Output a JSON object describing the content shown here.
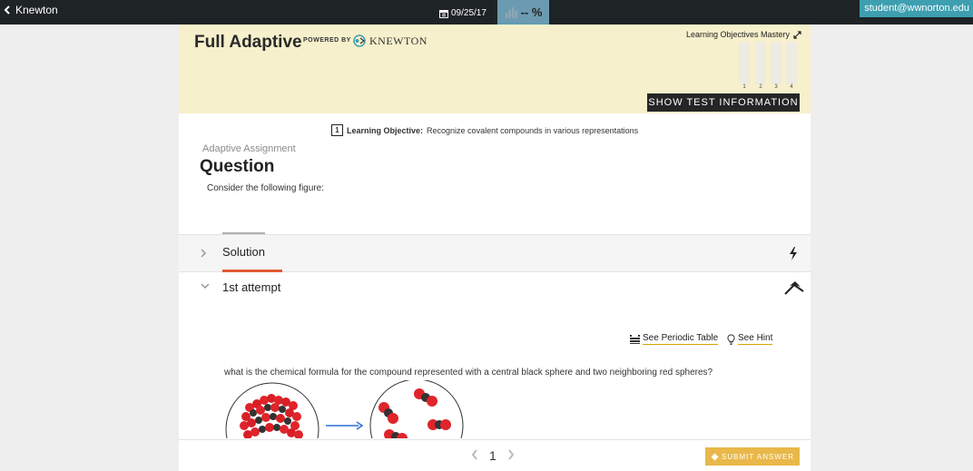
{
  "topbar": {
    "back_label": "Knewton",
    "date": "09/25/17",
    "score": "-- %",
    "user": "student@wwnorton.edu"
  },
  "header": {
    "title": "Full Adaptive",
    "powered_by": "POWERED BY",
    "brand": "KNEWTON",
    "mastery_title": "Learning Objectives Mastery",
    "mastery_labels": [
      "1",
      "2",
      "3",
      "4"
    ],
    "test_info_button": "SHOW TEST INFORMATION"
  },
  "learning_objective": {
    "number": "1",
    "label": "Learning Objective:",
    "text": "Recognize covalent compounds in various representations"
  },
  "question": {
    "assignment_type": "Adaptive Assignment",
    "heading": "Question",
    "prompt": "Consider the following figure:"
  },
  "solution": {
    "label": "Solution"
  },
  "attempt": {
    "label": "1st attempt"
  },
  "tools": {
    "periodic_table": "See Periodic Table",
    "hint": "See Hint"
  },
  "question_text": "what is the chemical formula for the compound represented with a central black sphere and two neighboring red spheres?",
  "footer": {
    "page": "1",
    "submit": "SUBMIT ANSWER"
  },
  "colors": {
    "topbar": "#1e2326",
    "header_bg": "#f7f0cc",
    "user_badge": "#3d9fb0",
    "score_bg": "#6c9bb1",
    "attempt_accent": "#e05a33",
    "submit": "#e9b84a"
  },
  "icons": [
    "chevron-left-icon",
    "calendar-icon",
    "bar-chart-icon",
    "expand-icon",
    "bolt-icon",
    "collapse-icon",
    "periodic-table-icon",
    "lightbulb-icon",
    "chevron-right-icon",
    "chevron-down-icon",
    "arrow-right-icon",
    "star-icon"
  ]
}
